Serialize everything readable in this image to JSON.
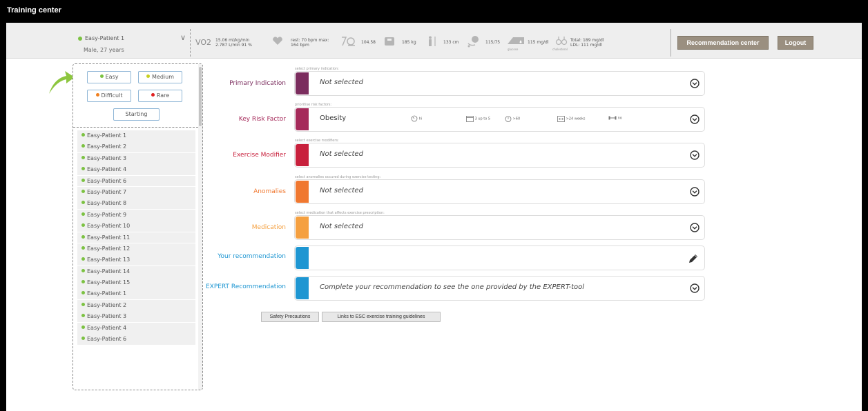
{
  "app": {
    "title": "Training center"
  },
  "patient": {
    "name": "Easy-Patient 1",
    "sub": "Male, 27 years",
    "status_color": "#7cc242"
  },
  "metrics": {
    "vo2_label": "VO2",
    "vo2_line1": "15.06 ml/kg/min",
    "vo2_line2": "2.787 L/min 91 %",
    "hr_line1": "rest: 70 bpm max:",
    "hr_line2": "164 bpm",
    "bmi": "104.58",
    "weight": "185 kg",
    "height": "133 cm",
    "bp": "115/75",
    "glucose": "115 mg/dl",
    "chol_line1": "Total: 189 mg/dl",
    "chol_line2": "LDL: 111 mg/dl",
    "glucose_caption": "glucose",
    "chol_caption": "cholesterol"
  },
  "header_buttons": {
    "recommendation": "Recommendation center",
    "logout": "Logout"
  },
  "filters": {
    "easy": "Easy",
    "medium": "Medium",
    "difficult": "Difficult",
    "rare": "Rare",
    "starting": "Starting"
  },
  "patient_list": [
    "Easy-Patient 1",
    "Easy-Patient 2",
    "Easy-Patient 3",
    "Easy-Patient 4",
    "Easy-Patient 6",
    "Easy-Patient 7",
    "Easy-Patient 8",
    "Easy-Patient 9",
    "Easy-Patient 10",
    "Easy-Patient 11",
    "Easy-Patient 12",
    "Easy-Patient 13",
    "Easy-Patient 14",
    "Easy-Patient 15",
    "Easy-Patient 1",
    "Easy-Patient 2",
    "Easy-Patient 3",
    "Easy-Patient 4",
    "Easy-Patient 6"
  ],
  "rows": {
    "primary": {
      "caption": "select primary indication:",
      "label": "Primary Indication",
      "value": "Not selected",
      "color": "#7b2d5e",
      "label_color": "#7b2d5e"
    },
    "risk": {
      "caption": "prioritise risk factors:",
      "label": "Key Risk Factor",
      "value": "Obesity",
      "color": "#a52a5a",
      "label_color": "#a52a5a",
      "i1": "hi",
      "i2": "3 up to 5",
      "i3": ">60",
      "i4": ">24 weeks",
      "i5": "no"
    },
    "modifier": {
      "caption": "select exercise modifiers:",
      "label": "Exercise Modifier",
      "value": "Not selected",
      "color": "#c8203c",
      "label_color": "#c8203c"
    },
    "anomalies": {
      "caption": "select anomalies occured during exercise testing:",
      "label": "Anomalies",
      "value": "Not selected",
      "color": "#f07830",
      "label_color": "#f07830"
    },
    "medication": {
      "caption": "select medication that affects exercise prescription:",
      "label": "Medication",
      "value": "Not selected",
      "color": "#f5a040",
      "label_color": "#f5a040"
    },
    "your_rec": {
      "label": "Your recommendation",
      "value": "",
      "color": "#1e96d2",
      "label_color": "#1e96d2"
    },
    "expert_rec": {
      "label": "EXPERT Recommendation",
      "value": "Complete your recommendation to see the one provided by the EXPERT-tool",
      "color": "#1e96d2",
      "label_color": "#1e96d2"
    }
  },
  "bottom_buttons": {
    "safety": "Safety Precautions",
    "links": "Links to ESC exercise training guidelines"
  }
}
